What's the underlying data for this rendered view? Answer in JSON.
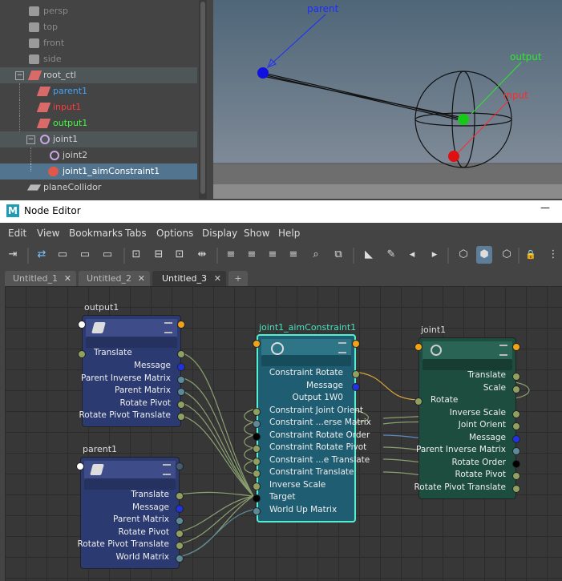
{
  "outliner": {
    "items": [
      {
        "label": "persp"
      },
      {
        "label": "top"
      },
      {
        "label": "front"
      },
      {
        "label": "side"
      },
      {
        "label": "root_ctl"
      },
      {
        "label": "parent1"
      },
      {
        "label": "input1"
      },
      {
        "label": "output1"
      },
      {
        "label": "joint1"
      },
      {
        "label": "joint2"
      },
      {
        "label": "joint1_aimConstraint1"
      },
      {
        "label": "planeCollidor"
      }
    ],
    "expand_minus": "−",
    "colors": {
      "parent1": "#3ea5ff",
      "input1": "#ff3a3a",
      "output1": "#3cff3c",
      "cam_text": "#8a8a8a",
      "default": "#cfcfcf"
    }
  },
  "viewport": {
    "labels": {
      "parent": "parent",
      "output": "output",
      "input": "input"
    },
    "colors": {
      "parent": "#1e2cff",
      "output": "#2bea2b",
      "input": "#ff2a2a"
    }
  },
  "node_editor": {
    "window_title": "Node Editor",
    "app_letter": "M",
    "minimize_glyph": "—",
    "menus": [
      "Edit",
      "View",
      "Bookmarks",
      "Tabs",
      "Options",
      "Display",
      "Show",
      "Help"
    ],
    "tabs": [
      {
        "label": "Untitled_1",
        "close": "✕"
      },
      {
        "label": "Untitled_2",
        "close": "✕"
      },
      {
        "label": "Untitled_3",
        "close": "✕"
      }
    ],
    "add_tab": "+",
    "toolbar_glyphs": [
      "⇥",
      "⇄",
      "▭",
      "▭",
      "▭",
      "▭",
      "⊡",
      "⊟",
      "⊡",
      "⇹",
      "≡",
      "≡",
      "≡",
      "≡",
      "⌕",
      "⧉",
      "◣",
      "✎",
      "◂",
      "▸",
      "⬡",
      "⬢",
      "⬡",
      "🔒",
      "⋮"
    ],
    "nodes": {
      "output1": {
        "title": "output1",
        "plugs": [
          "Translate",
          "Message",
          "Parent Inverse Matrix",
          "Parent Matrix",
          "Rotate Pivot",
          "Rotate Pivot Translate"
        ]
      },
      "parent1": {
        "title": "parent1",
        "plugs": [
          "Translate",
          "Message",
          "Parent Matrix",
          "Rotate Pivot",
          "Rotate Pivot Translate",
          "World Matrix"
        ]
      },
      "constraint": {
        "title": "joint1_aimConstraint1",
        "plugs": [
          "Constraint Rotate",
          "Message",
          "Output 1W0",
          "Constraint Joint Orient",
          "Constraint ...erse Matrix",
          "Constraint Rotate Order",
          "Constraint Rotate Pivot",
          "Constraint ...e Translate",
          "Constraint Translate",
          "Inverse Scale",
          "Target",
          "World Up Matrix"
        ]
      },
      "joint1": {
        "title": "joint1",
        "plugs": [
          "Translate",
          "Scale",
          "Rotate",
          "Inverse Scale",
          "Joint Orient",
          "Message",
          "Parent Inverse Matrix",
          "Rotate Order",
          "Rotate Pivot",
          "Rotate Pivot Translate"
        ]
      }
    }
  }
}
